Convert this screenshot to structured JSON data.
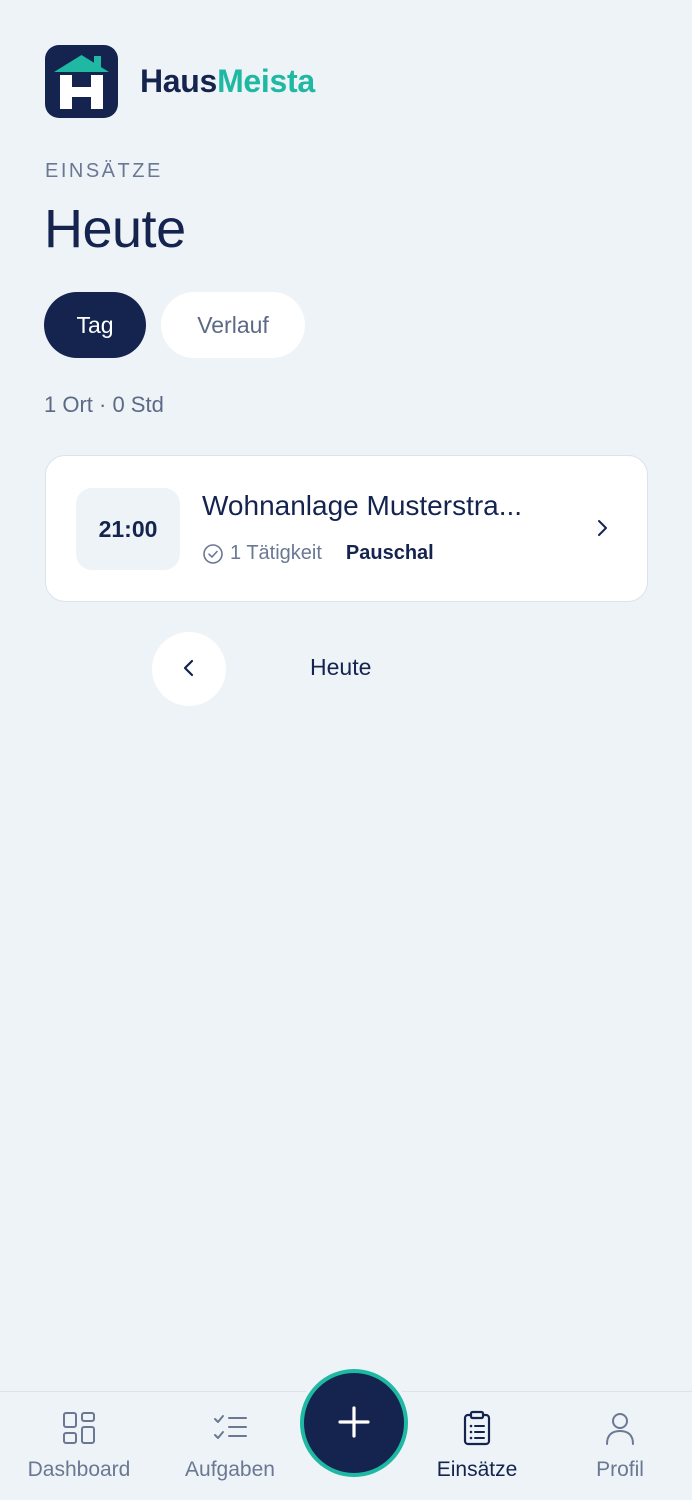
{
  "brand": {
    "name_part1": "Haus",
    "name_part2": "Meista"
  },
  "header": {
    "eyebrow": "EINSÄTZE",
    "title": "Heute"
  },
  "tabs": [
    {
      "label": "Tag",
      "active": true
    },
    {
      "label": "Verlauf",
      "active": false
    }
  ],
  "summary": "1 Ort · 0 Std",
  "assignments": [
    {
      "time": "21:00",
      "title": "Wohnanlage Musterstra...",
      "activity_count": "1 Tätigkeit",
      "billing": "Pauschal"
    }
  ],
  "day_nav": {
    "label": "Heute"
  },
  "bottom_nav": [
    {
      "label": "Dashboard",
      "icon": "dashboard-icon",
      "active": false
    },
    {
      "label": "Aufgaben",
      "icon": "checklist-icon",
      "active": false
    },
    {
      "label": "Einsätze",
      "icon": "clipboard-icon",
      "active": true
    },
    {
      "label": "Profil",
      "icon": "user-icon",
      "active": false
    }
  ],
  "fab": {
    "icon": "plus-icon"
  },
  "colors": {
    "primary": "#14244f",
    "accent": "#1fb8a3",
    "background": "#eef3f7",
    "muted": "#6b7893"
  }
}
